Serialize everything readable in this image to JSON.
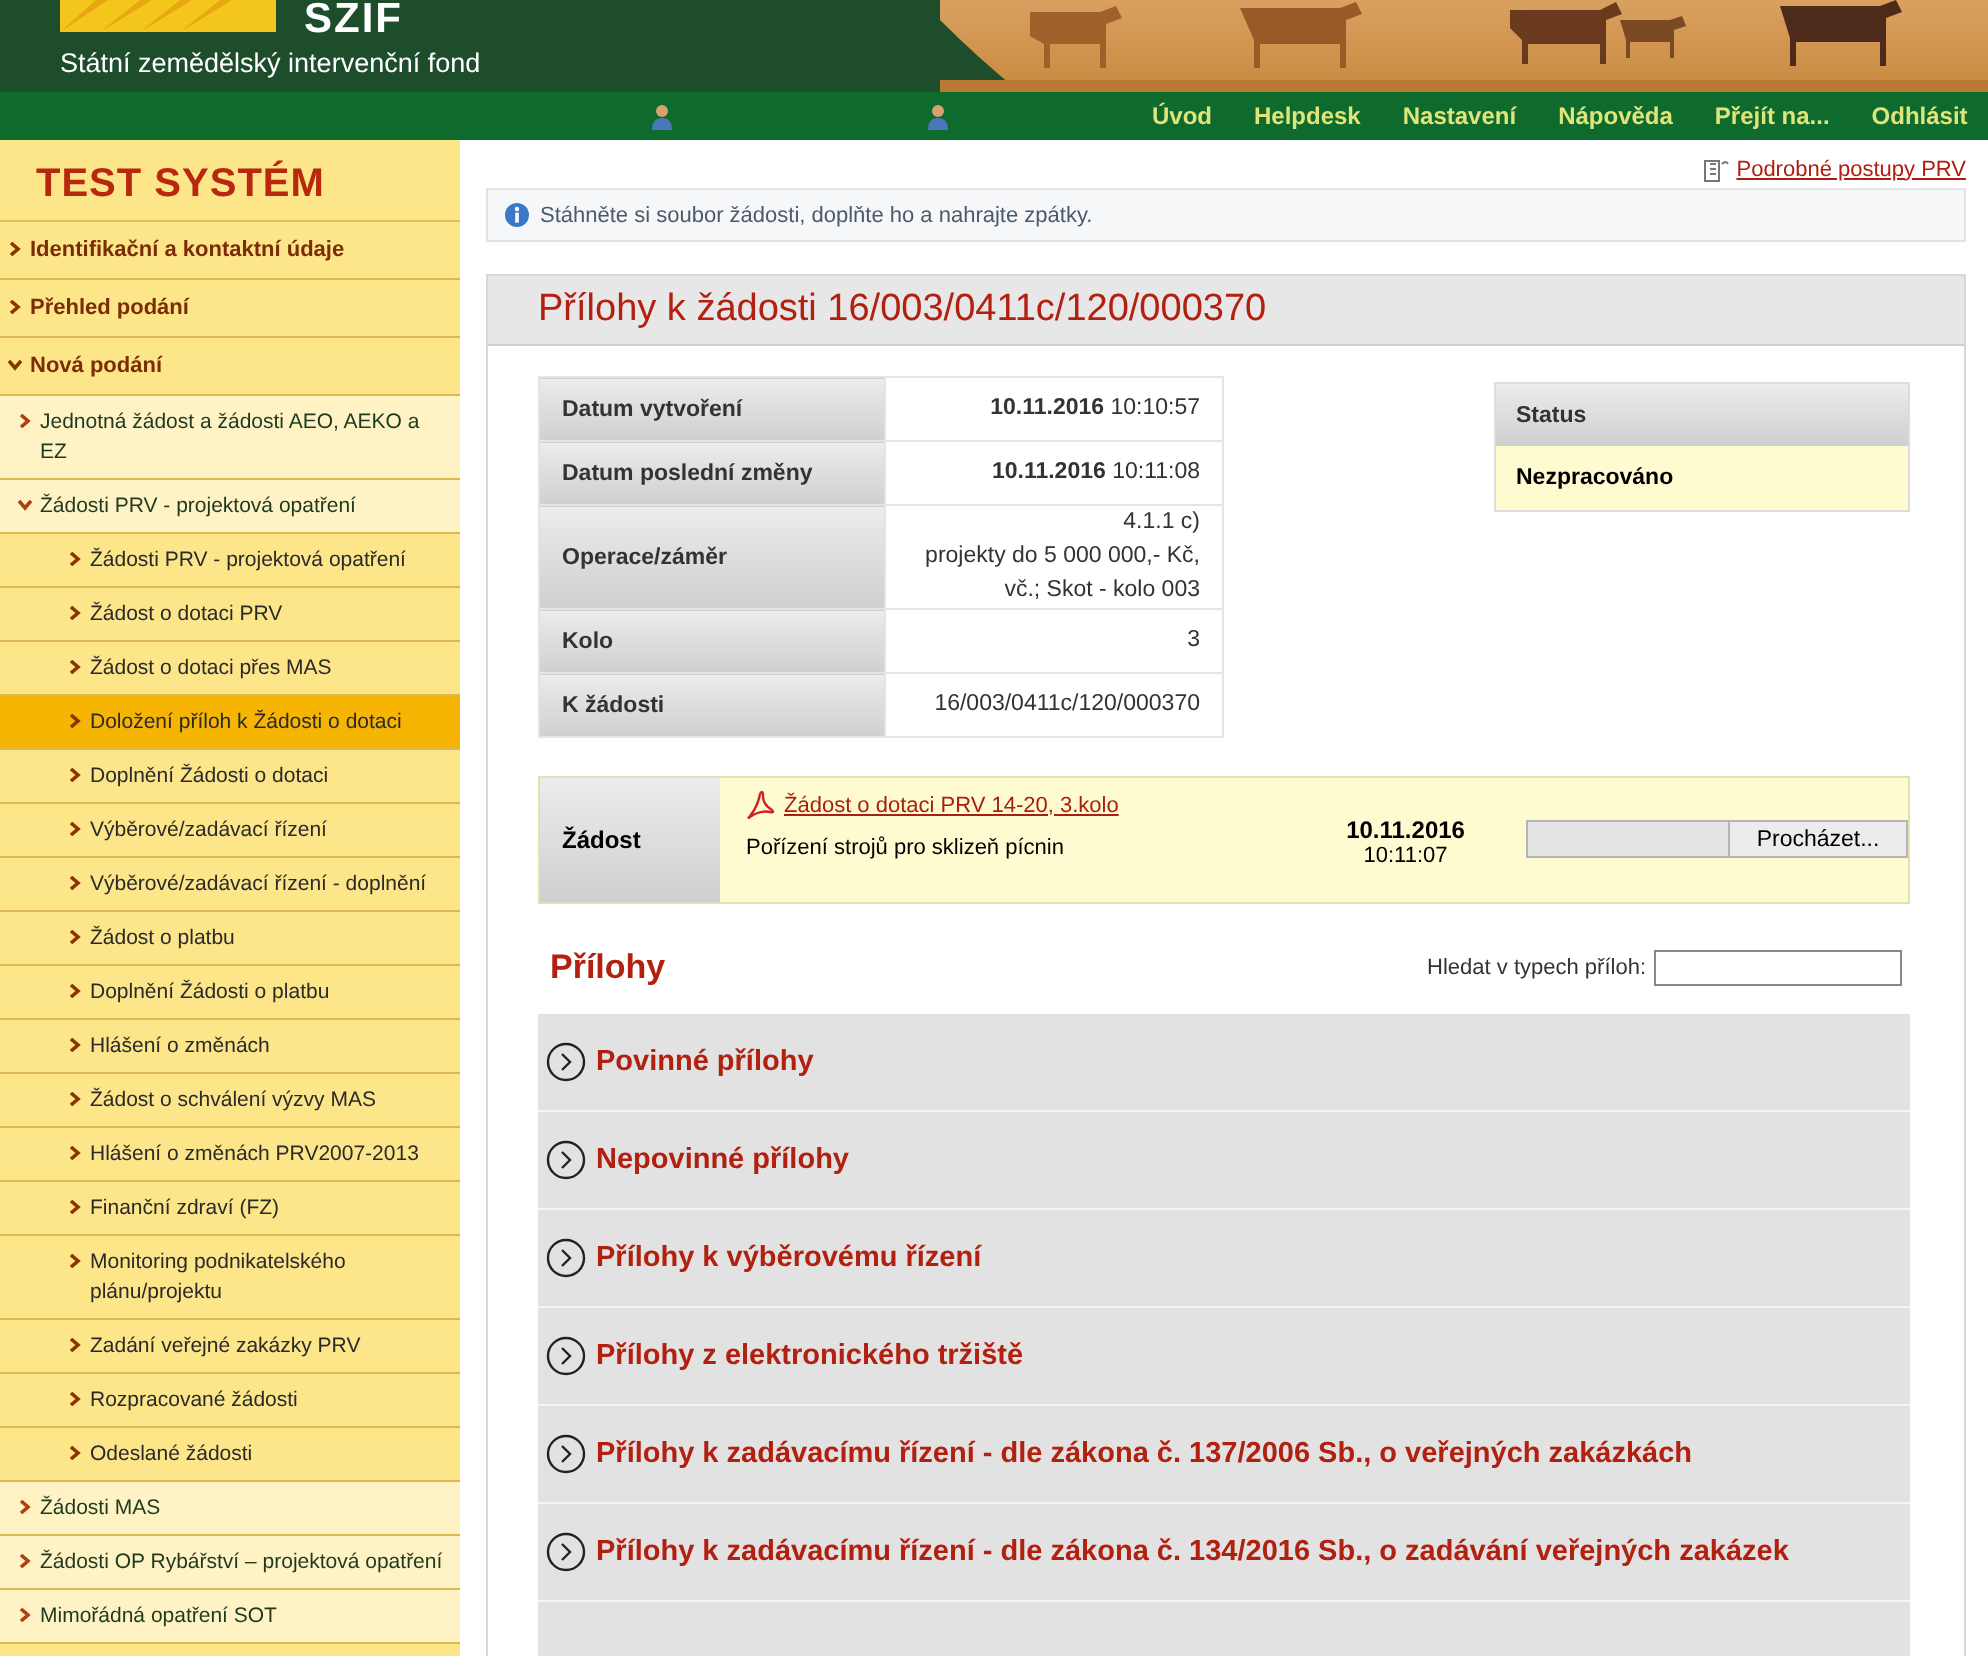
{
  "header": {
    "logo_text": "SZIF",
    "subtitle": "Státní zemědělský intervenční fond"
  },
  "nav": [
    {
      "label": "Úvod"
    },
    {
      "label": "Helpdesk"
    },
    {
      "label": "Nastavení"
    },
    {
      "label": "Nápověda"
    },
    {
      "label": "Přejít na..."
    },
    {
      "label": "Odhlásit"
    }
  ],
  "sidebar": {
    "title": "TEST SYSTÉM",
    "items": [
      {
        "label": "Identifikační a kontaktní údaje",
        "expanded": false,
        "selected": false
      },
      {
        "label": "Přehled podání",
        "expanded": false,
        "selected": false
      },
      {
        "label": "Nová podání",
        "expanded": true,
        "selected": false,
        "children": [
          {
            "label": "Jednotná žádost a žádosti AEO, AEKO a EZ",
            "expanded": false,
            "selected": false
          },
          {
            "label": "Žádosti PRV - projektová opatření",
            "expanded": true,
            "selected": false,
            "children": [
              {
                "label": "Žádosti PRV - projektová opatření",
                "expanded": false,
                "selected": false
              },
              {
                "label": "Žádost o dotaci PRV",
                "expanded": false,
                "selected": false
              },
              {
                "label": "Žádost o dotaci přes MAS",
                "expanded": false,
                "selected": false
              },
              {
                "label": "Doložení příloh k Žádosti o dotaci",
                "expanded": false,
                "selected": true
              },
              {
                "label": "Doplnění Žádosti o dotaci",
                "expanded": false,
                "selected": false
              },
              {
                "label": "Výběrové/zadávací řízení",
                "expanded": false,
                "selected": false
              },
              {
                "label": "Výběrové/zadávací řízení - doplnění",
                "expanded": false,
                "selected": false
              },
              {
                "label": "Žádost o platbu",
                "expanded": false,
                "selected": false
              },
              {
                "label": "Doplnění Žádosti o platbu",
                "expanded": false,
                "selected": false
              },
              {
                "label": "Hlášení o změnách",
                "expanded": false,
                "selected": false
              },
              {
                "label": "Žádost o schválení výzvy MAS",
                "expanded": false,
                "selected": false
              },
              {
                "label": "Hlášení o změnách PRV2007-2013",
                "expanded": false,
                "selected": false
              },
              {
                "label": "Finanční zdraví (FZ)",
                "expanded": false,
                "selected": false
              },
              {
                "label": "Monitoring podnikatelského plánu/projektu",
                "expanded": false,
                "selected": false
              },
              {
                "label": "Zadání veřejné zakázky PRV",
                "expanded": false,
                "selected": false
              },
              {
                "label": "Rozpracované žádosti",
                "expanded": false,
                "selected": false
              },
              {
                "label": "Odeslané žádosti",
                "expanded": false,
                "selected": false
              }
            ]
          },
          {
            "label": "Žádosti MAS",
            "expanded": false,
            "selected": false
          },
          {
            "label": "Žádosti OP Rybářství – projektová opatření",
            "expanded": false,
            "selected": false
          },
          {
            "label": "Mimořádná opatření SOT",
            "expanded": false,
            "selected": false
          }
        ]
      }
    ]
  },
  "help_link": "Podrobné postupy PRV",
  "info": "Stáhněte si soubor žádosti, doplňte ho a nahrajte zpátky.",
  "panel": {
    "title": "Přílohy k žádosti 16/003/0411c/120/000370",
    "details": [
      {
        "label": "Datum vytvoření",
        "lines": [
          "**10.11.2016** 10:10:57"
        ]
      },
      {
        "label": "Datum poslední změny",
        "lines": [
          "**10.11.2016** 10:11:08"
        ]
      },
      {
        "label": "Operace/záměr",
        "lines": [
          "4.1.1 c)",
          "projekty do 5 000 000,- Kč,",
          "vč.; Skot - kolo 003"
        ]
      },
      {
        "label": "Kolo",
        "lines": [
          "3"
        ]
      },
      {
        "label": "K žádosti",
        "lines": [
          "16/003/0411c/120/000370"
        ]
      }
    ],
    "status": {
      "heading": "Status",
      "value": "Nezpracováno"
    },
    "request": {
      "label": "Žádost",
      "file_link": "Žádost o dotaci PRV 14-20, 3.kolo",
      "description": "Pořízení strojů pro sklizeň pícnin",
      "date": "10.11.2016",
      "time": "10:11:07",
      "browse_button": "Procházet..."
    },
    "attachments": {
      "title": "Přílohy",
      "search_label": "Hledat v typech příloh:",
      "sections": [
        {
          "title": "Povinné přílohy"
        },
        {
          "title": "Nepovinné přílohy"
        },
        {
          "title": "Přílohy k výběrovému řízení"
        },
        {
          "title": "Přílohy z elektronického tržiště"
        },
        {
          "title": "Přílohy k zadávacímu řízení - dle zákona č. 137/2006 Sb., o veřejných zakázkách"
        },
        {
          "title": "Přílohy k zadávacímu řízení - dle zákona č. 134/2016 Sb., o zadávání veřejných zakázek"
        }
      ]
    }
  }
}
